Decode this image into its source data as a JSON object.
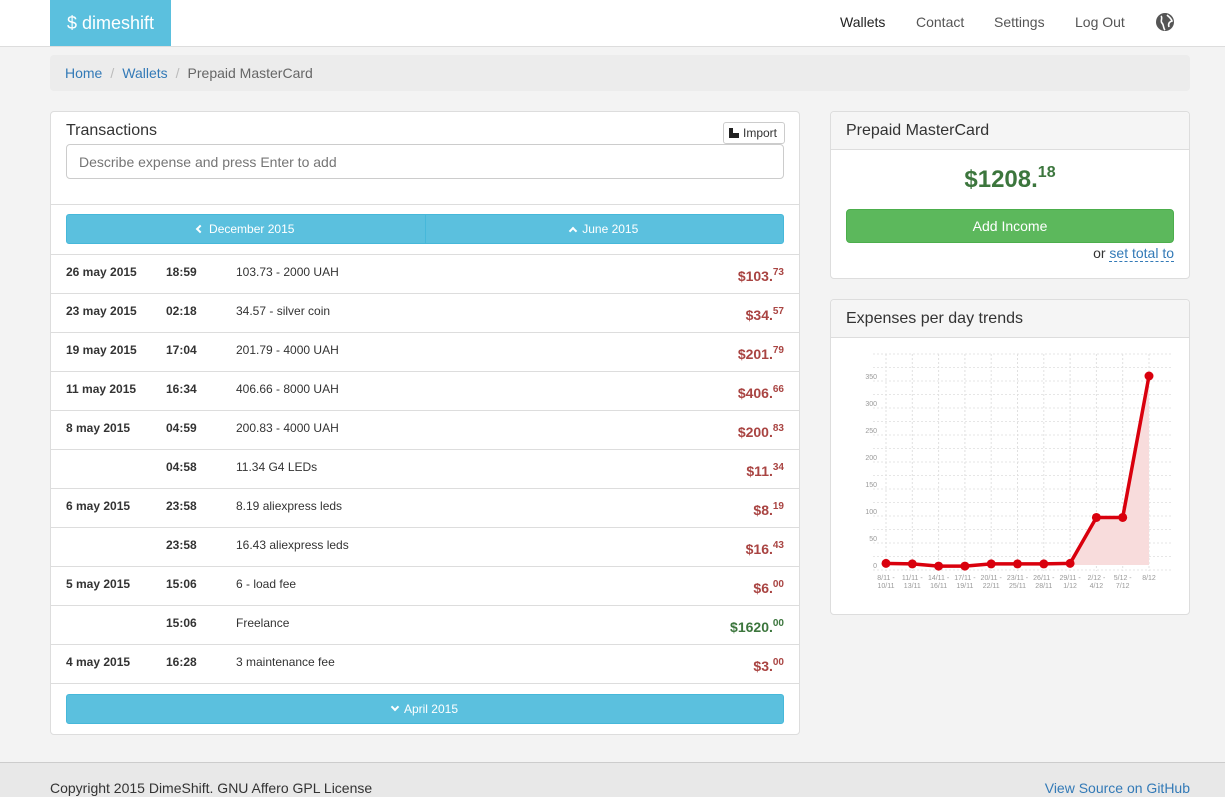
{
  "navbar": {
    "brand": "$ dimeshift",
    "items": [
      "Wallets",
      "Contact",
      "Settings",
      "Log Out"
    ],
    "globe_icon": "globe-icon"
  },
  "breadcrumb": [
    "Home",
    "Wallets",
    "Prepaid MasterCard"
  ],
  "transactions": {
    "title": "Transactions",
    "import_label": "Import",
    "input_placeholder": "Describe expense and press Enter to add",
    "prev_month": "December 2015",
    "next_month": "June 2015",
    "older_month": "April 2015",
    "rows": [
      {
        "date": "26 may 2015",
        "time": "18:59",
        "desc": "103.73 - 2000 UAH",
        "whole": "$103.",
        "cents": "73",
        "income": false
      },
      {
        "date": "23 may 2015",
        "time": "02:18",
        "desc": "34.57 - silver coin",
        "whole": "$34.",
        "cents": "57",
        "income": false
      },
      {
        "date": "19 may 2015",
        "time": "17:04",
        "desc": "201.79 - 4000 UAH",
        "whole": "$201.",
        "cents": "79",
        "income": false
      },
      {
        "date": "11 may 2015",
        "time": "16:34",
        "desc": "406.66 - 8000 UAH",
        "whole": "$406.",
        "cents": "66",
        "income": false
      },
      {
        "date": "8 may 2015",
        "time": "04:59",
        "desc": "200.83 - 4000 UAH",
        "whole": "$200.",
        "cents": "83",
        "income": false
      },
      {
        "date": "",
        "time": "04:58",
        "desc": "11.34 G4 LEDs",
        "whole": "$11.",
        "cents": "34",
        "income": false
      },
      {
        "date": "6 may 2015",
        "time": "23:58",
        "desc": "8.19 aliexpress leds",
        "whole": "$8.",
        "cents": "19",
        "income": false
      },
      {
        "date": "",
        "time": "23:58",
        "desc": "16.43 aliexpress leds",
        "whole": "$16.",
        "cents": "43",
        "income": false
      },
      {
        "date": "5 may 2015",
        "time": "15:06",
        "desc": "6 - load fee",
        "whole": "$6.",
        "cents": "00",
        "income": false
      },
      {
        "date": "",
        "time": "15:06",
        "desc": "Freelance",
        "whole": "$1620.",
        "cents": "00",
        "income": true
      },
      {
        "date": "4 may 2015",
        "time": "16:28",
        "desc": "3 maintenance fee",
        "whole": "$3.",
        "cents": "00",
        "income": false
      }
    ]
  },
  "wallet": {
    "title": "Prepaid MasterCard",
    "balance_whole": "$1208.",
    "balance_cents": "18",
    "add_income_label": "Add Income",
    "or_text": "or",
    "set_total_label": "set total to"
  },
  "trends": {
    "title": "Expenses per day trends"
  },
  "chart_data": {
    "type": "area",
    "categories": [
      [
        "8/11 -",
        "10/11"
      ],
      [
        "11/11 -",
        "13/11"
      ],
      [
        "14/11 -",
        "16/11"
      ],
      [
        "17/11 -",
        "19/11"
      ],
      [
        "20/11 -",
        "22/11"
      ],
      [
        "23/11 -",
        "25/11"
      ],
      [
        "26/11 -",
        "28/11"
      ],
      [
        "29/11 -",
        "1/12"
      ],
      [
        "2/12 -",
        "4/12"
      ],
      [
        "5/12 -",
        "7/12"
      ],
      [
        "8/12",
        ""
      ]
    ],
    "values": [
      3,
      2,
      -2,
      -2,
      2,
      2,
      2,
      3,
      88,
      88,
      350
    ],
    "yticks": [
      0,
      50,
      100,
      150,
      200,
      250,
      300,
      350
    ],
    "ylim": [
      -10,
      390
    ],
    "grid": true,
    "line_color": "#d9000d",
    "fill_color": "#f8dcdc"
  },
  "footer": {
    "copyright": "Copyright 2015 DimeShift. GNU Affero GPL License",
    "source_link": "View Source on GitHub"
  }
}
